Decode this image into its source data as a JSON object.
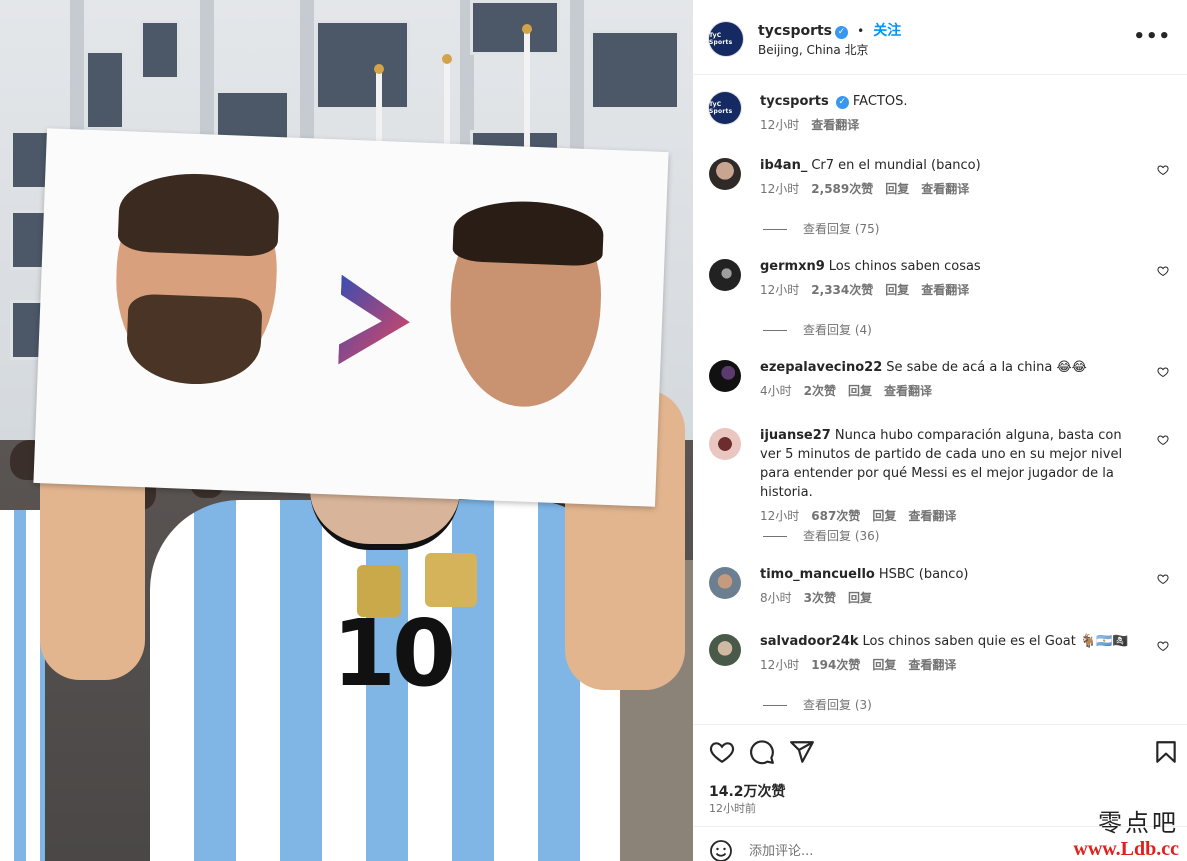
{
  "colors": {
    "link": "#0095f6",
    "verified": "#3897f0",
    "muted": "#737373",
    "text": "#262626"
  },
  "photo": {
    "jersey_number": "10"
  },
  "header": {
    "avatar_text": "TyC Sports",
    "username": "tycsports",
    "separator": "•",
    "follow_label": "关注",
    "location": "Beijing, China 北京",
    "more_icon": "more-horizontal-icon"
  },
  "caption": {
    "username": "tycsports",
    "text": "FACTOS.",
    "time": "12小时",
    "translate": "查看翻译"
  },
  "comments": [
    {
      "username": "ib4an_",
      "text": "Cr7 en el mundial (banco)",
      "time": "12小时",
      "likes": "2,589次赞",
      "reply": "回复",
      "translate": "查看翻译",
      "replies": "查看回复 (75)"
    },
    {
      "username": "germxn9",
      "text": "Los chinos saben cosas",
      "time": "12小时",
      "likes": "2,334次赞",
      "reply": "回复",
      "translate": "查看翻译",
      "replies": "查看回复 (4)"
    },
    {
      "username": "ezepalavecino22",
      "text": "Se sabe de acá a la china 😂😂",
      "time": "4小时",
      "likes": "2次赞",
      "reply": "回复",
      "translate": "查看翻译",
      "replies": ""
    },
    {
      "username": "ijuanse27",
      "text": "Nunca hubo comparación alguna, basta con ver 5 minutos de partido de cada uno en su mejor nivel para entender por qué Messi es el mejor jugador de la historia.",
      "time": "12小时",
      "likes": "687次赞",
      "reply": "回复",
      "translate": "查看翻译",
      "replies": "查看回复 (36)"
    },
    {
      "username": "timo_mancuello",
      "text": "HSBC (banco)",
      "time": "8小时",
      "likes": "3次赞",
      "reply": "回复",
      "translate": "",
      "replies": ""
    },
    {
      "username": "salvadoor24k",
      "text": "Los chinos saben quie es el Goat 🐐🇦🇷🏴‍☠️",
      "time": "12小时",
      "likes": "194次赞",
      "reply": "回复",
      "translate": "查看翻译",
      "replies": "查看回复 (3)"
    }
  ],
  "actions": {
    "like_icon": "heart-icon",
    "comment_icon": "comment-icon",
    "share_icon": "paper-plane-icon",
    "save_icon": "bookmark-icon",
    "likes_count": "14.2万次赞",
    "posted_ago": "12小时前"
  },
  "add_comment": {
    "placeholder": "添加评论..."
  },
  "watermark": {
    "line1": "零点吧",
    "line2": "www.Ldb.cc"
  }
}
